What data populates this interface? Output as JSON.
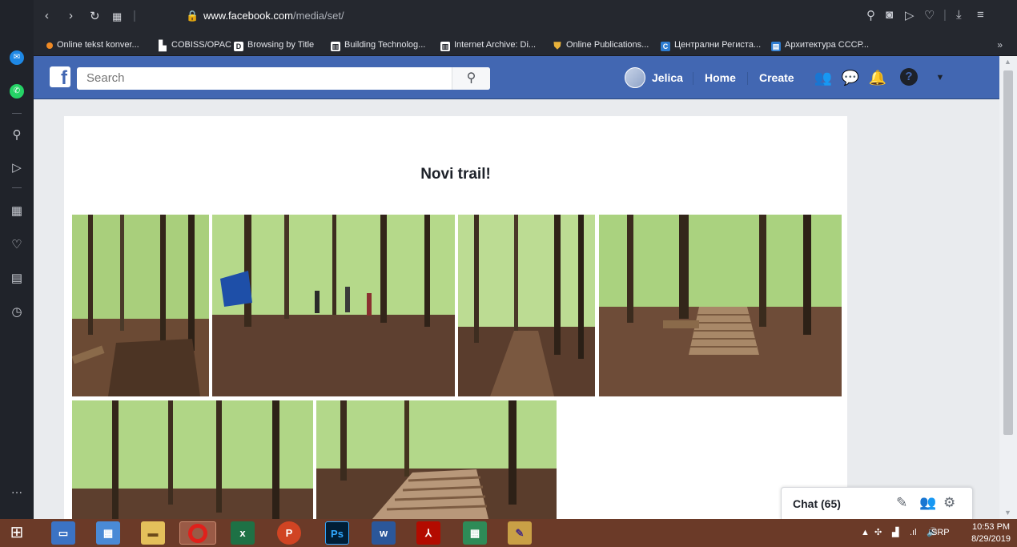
{
  "browser": {
    "url_host": "www.facebook.com",
    "url_path": "/media/set/",
    "bookmarks": [
      {
        "label": "Online tekst konver...",
        "color": "#f08a24",
        "icon": "O"
      },
      {
        "label": "COBISS/OPAC",
        "color": "#ffffff",
        "icon": "doc"
      },
      {
        "label": "Browsing by Title",
        "color": "#ffffff",
        "icon": "D"
      },
      {
        "label": "Building Technolog...",
        "color": "#ffffff",
        "icon": "archive"
      },
      {
        "label": "Internet Archive: Di...",
        "color": "#ffffff",
        "icon": "archive"
      },
      {
        "label": "Online Publications...",
        "color": "#e8b13a",
        "icon": "shield"
      },
      {
        "label": "Централни Региста...",
        "color": "#2d7cd1",
        "icon": "C"
      },
      {
        "label": "Архитектура СССР...",
        "color": "#2d7cd1",
        "icon": "book"
      }
    ],
    "more_label": "»"
  },
  "fb": {
    "search_placeholder": "Search",
    "user_name": "Jelica",
    "nav_home": "Home",
    "nav_create": "Create",
    "header_color": "#4267b2"
  },
  "album": {
    "title": "Novi trail!"
  },
  "chat": {
    "label": "Chat (65)"
  },
  "taskbar": {
    "language": "SRP",
    "time": "10:53 PM",
    "date": "8/29/2019",
    "apps": [
      {
        "name": "start",
        "label": ""
      },
      {
        "name": "desktop",
        "label": ""
      },
      {
        "name": "control-panel",
        "label": ""
      },
      {
        "name": "file-explorer",
        "label": ""
      },
      {
        "name": "opera",
        "label": "O"
      },
      {
        "name": "excel",
        "label": "x"
      },
      {
        "name": "powerpoint",
        "label": "P"
      },
      {
        "name": "photoshop",
        "label": "Ps"
      },
      {
        "name": "word",
        "label": "w"
      },
      {
        "name": "acrobat",
        "label": ""
      },
      {
        "name": "calculator",
        "label": ""
      },
      {
        "name": "paint",
        "label": ""
      }
    ]
  }
}
